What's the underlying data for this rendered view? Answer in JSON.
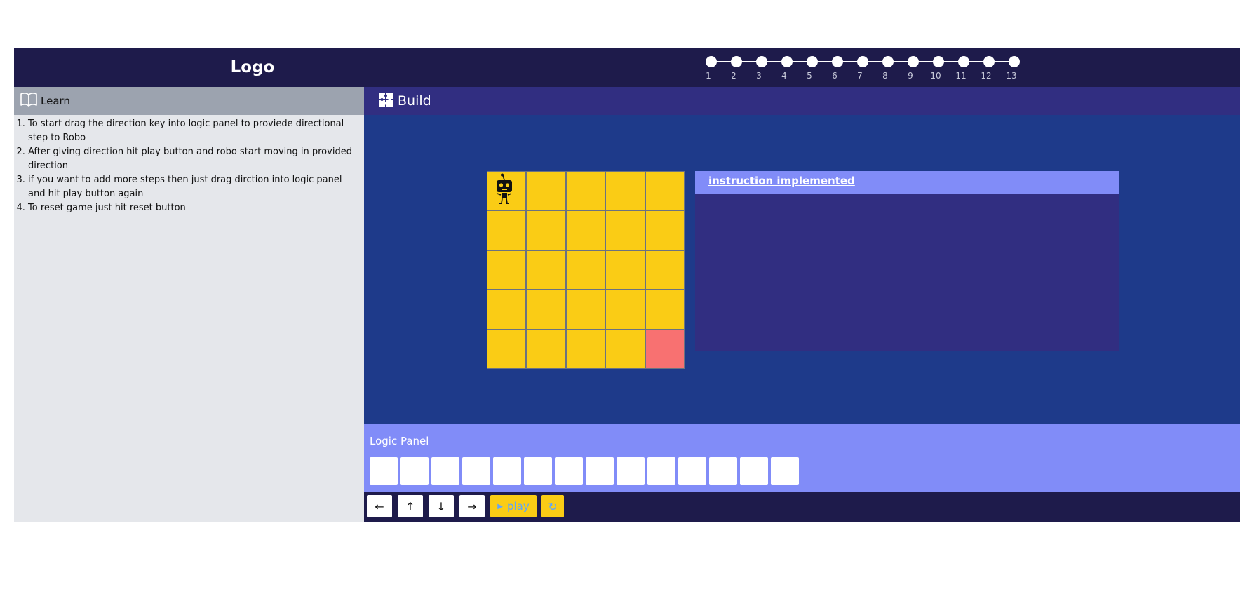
{
  "header": {
    "logo": "Logo",
    "steps": [
      "1",
      "2",
      "3",
      "4",
      "5",
      "6",
      "7",
      "8",
      "9",
      "10",
      "11",
      "12",
      "13"
    ]
  },
  "learn": {
    "title": "Learn",
    "icon": "book-icon",
    "instructions": [
      "To start drag the direction key into logic panel to proviede directional step to Robo",
      "After giving direction hit play button and robo start moving in provided direction",
      "if you want to add more steps then just drag dirction into logic panel and hit play button again",
      "To reset game just hit reset button"
    ]
  },
  "build": {
    "title": "Build",
    "icon": "puzzle-icon",
    "instruction_panel_title": "instruction implemented"
  },
  "logic_panel": {
    "title": "Logic Panel",
    "slot_count": 14
  },
  "controls": {
    "left_icon": "←",
    "up_icon": "↑",
    "down_icon": "↓",
    "right_icon": "→",
    "play_label": "play",
    "play_icon": "▶",
    "reset_icon": "↻"
  },
  "colors": {
    "header_bg": "#1e1b4b",
    "build_bg": "#1e3a8a",
    "panel_bg": "#312e81",
    "accent": "#818cf8",
    "grid_cell": "#facc15",
    "goal_cell": "#f87171",
    "learn_bg": "#e5e7eb"
  }
}
